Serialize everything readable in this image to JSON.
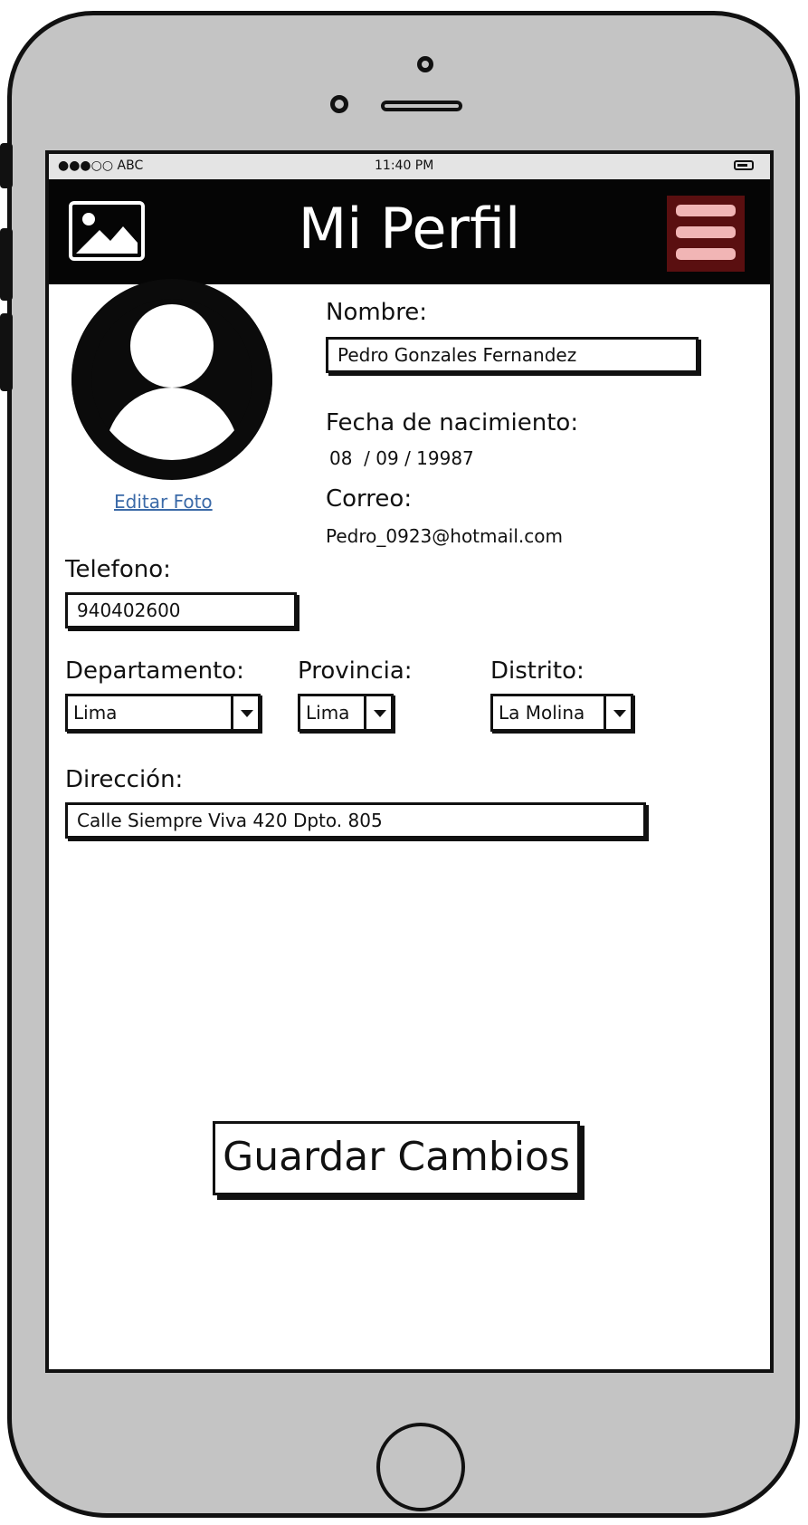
{
  "status_bar": {
    "carrier": "●●●○○ ABC",
    "time": "11:40 PM"
  },
  "header": {
    "title": "Mi Perfil",
    "left_icon": "image-icon",
    "right_icon": "hamburger-menu-icon",
    "menu_color": "#5a0f10",
    "menu_bar_color": "#f1b5b5"
  },
  "profile": {
    "avatar_icon": "user-avatar-icon",
    "edit_photo_label": "Editar Foto"
  },
  "form": {
    "nombre": {
      "label": "Nombre:",
      "value": "Pedro Gonzales Fernandez"
    },
    "fecha": {
      "label": "Fecha de nacimiento:",
      "value": "08  / 09 / 19987"
    },
    "correo": {
      "label": "Correo:",
      "value": "Pedro_0923@hotmail.com"
    },
    "telefono": {
      "label": "Telefono:",
      "value": "940402600"
    },
    "departamento": {
      "label": "Departamento:",
      "value": "Lima"
    },
    "provincia": {
      "label": "Provincia:",
      "value": "Lima"
    },
    "distrito": {
      "label": "Distrito:",
      "value": "La Molina"
    },
    "direccion": {
      "label": "Dirección:",
      "value": "Calle Siempre Viva 420 Dpto. 805"
    }
  },
  "actions": {
    "save_label": "Guardar Cambios"
  }
}
